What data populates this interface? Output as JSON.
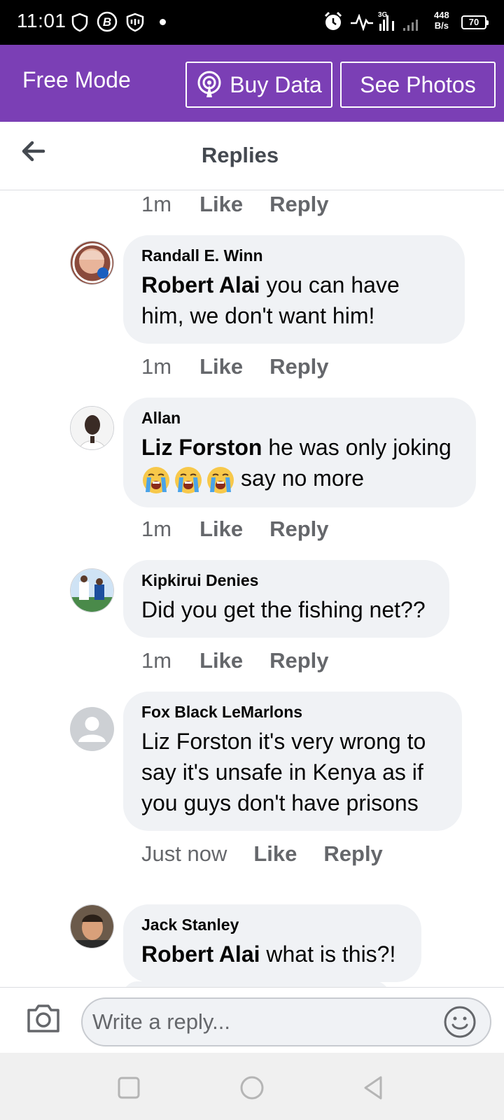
{
  "status_bar": {
    "time": "11:01",
    "net_speed_value": "448",
    "net_speed_unit": "B/s",
    "battery": "70",
    "network_label": "3G"
  },
  "promo": {
    "title": "Free Mode",
    "buy_data": "Buy Data",
    "see_photos": "See Photos",
    "color": "#7b3fb5"
  },
  "header": {
    "title": "Replies"
  },
  "top_meta": {
    "time": "1m",
    "like": "Like",
    "reply": "Reply"
  },
  "comments": [
    {
      "author": "Randall E. Winn",
      "mention": "Robert Alai",
      "text": " you can have him, we don't want him!",
      "time": "1m",
      "like": "Like",
      "reply": "Reply"
    },
    {
      "author": "Allan",
      "mention": "Liz Forston",
      "text": " he was only joking",
      "text2": "say no more",
      "emoji": "loudly-crying-face",
      "time": "1m",
      "like": "Like",
      "reply": "Reply"
    },
    {
      "author": "Kipkirui Denies",
      "text": "Did you get the fishing net??",
      "time": "1m",
      "like": "Like",
      "reply": "Reply"
    },
    {
      "author": "Fox Black LeMarlons",
      "text": "Liz Forston it's very wrong to say it's unsafe in Kenya as if you guys don't have prisons",
      "time": "Just now",
      "like": "Like",
      "reply": "Reply"
    },
    {
      "author": "Jack Stanley",
      "mention": "Robert Alai",
      "text": " what is this?!"
    }
  ],
  "reply_bar": {
    "placeholder": "Write a reply..."
  },
  "icons": {
    "back": "arrow-left-icon",
    "camera": "camera-icon",
    "emoji": "smiley-icon",
    "nav_recent": "square-icon",
    "nav_home": "circle-icon",
    "nav_back": "triangle-back-icon"
  }
}
